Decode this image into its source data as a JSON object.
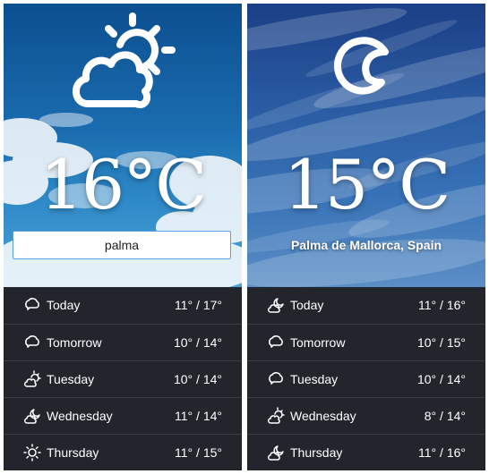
{
  "screens": [
    {
      "temperature": "16°C",
      "search": {
        "value": "palma"
      },
      "icon": "partly-cloudy-day-icon",
      "forecast": [
        {
          "day": "Today",
          "range": "11° / 17°",
          "icon": "chat-cloud-icon"
        },
        {
          "day": "Tomorrow",
          "range": "10° / 14°",
          "icon": "chat-cloud-icon"
        },
        {
          "day": "Tuesday",
          "range": "10° / 14°",
          "icon": "partly-cloudy-icon"
        },
        {
          "day": "Wednesday",
          "range": "11° / 14°",
          "icon": "cloudy-moon-icon"
        },
        {
          "day": "Thursday",
          "range": "11° / 15°",
          "icon": "sun-icon"
        }
      ]
    },
    {
      "temperature": "15°C",
      "location": "Palma de Mallorca, Spain",
      "icon": "moon-icon",
      "forecast": [
        {
          "day": "Today",
          "range": "11° / 16°",
          "icon": "cloudy-moon-icon"
        },
        {
          "day": "Tomorrow",
          "range": "10° / 15°",
          "icon": "chat-cloud-icon"
        },
        {
          "day": "Tuesday",
          "range": "10° / 14°",
          "icon": "chat-cloud-icon"
        },
        {
          "day": "Wednesday",
          "range": "8° / 14°",
          "icon": "partly-cloudy-icon"
        },
        {
          "day": "Thursday",
          "range": "11° / 16°",
          "icon": "cloudy-moon-icon"
        }
      ]
    }
  ],
  "colors": {
    "forecast_bg": "#23252c",
    "divider": "#3a3d45",
    "input_border": "#5da0dc"
  }
}
